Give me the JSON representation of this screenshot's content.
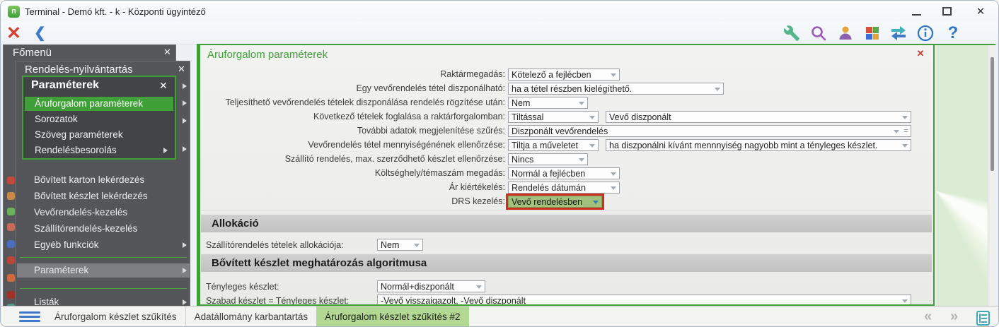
{
  "window": {
    "title": "Terminal - Demó kft. - k - Központi ügyintéző",
    "app_icon_letter": "n"
  },
  "icons": {
    "exit_x": "✕",
    "back_chevron": "❮",
    "window_close_x": "✕",
    "panel_close_x": "✕",
    "sidebar_close_x": "✕",
    "help_question": "?",
    "page_prev": "«",
    "page_next": "»",
    "equals_glyph": "="
  },
  "sidebar": {
    "fomenu": {
      "title": "Főmenü"
    },
    "orders_panel": {
      "title": "Rendelés-nyilvántartás",
      "items": [
        {
          "label": "Bővített karton lekérdezés"
        },
        {
          "label": "Bővített készlet lekérdezés"
        },
        {
          "label": "Vevőrendelés-kezelés"
        },
        {
          "label": "Szállítórendelés-kezelés"
        },
        {
          "label": "Egyéb funkciók"
        },
        {
          "label": "Paraméterek"
        },
        {
          "label": "Listák"
        }
      ]
    },
    "params_panel": {
      "title": "Paraméterek",
      "items": [
        {
          "label": "Áruforgalom paraméterek",
          "selected": true
        },
        {
          "label": "Sorozatok"
        },
        {
          "label": "Szöveg paraméterek"
        },
        {
          "label": "Rendelésbesorolás"
        }
      ]
    }
  },
  "main": {
    "title": "Áruforgalom paraméterek",
    "rows": [
      {
        "label": "Raktármegadás:",
        "value": "Kötelező a fejlécben"
      },
      {
        "label": "Egy vevőrendelés tétel diszponálható:",
        "value": "ha a tétel részben kielégíthető."
      },
      {
        "label": "Teljesíthető vevőrendelés tételek diszponálása rendelés rögzítése után:",
        "value": "Nem"
      },
      {
        "label": "Következő tételek foglalása a raktárforgalomban:",
        "value": "Tiltással",
        "value2": "Vevő diszponált"
      },
      {
        "label": "További adatok megjelenítése szűrés:",
        "value": "Diszponált vevőrendelés"
      },
      {
        "label": "Vevőrendelés tétel mennyiségénének ellenőrzése:",
        "value": "Tiltja a műveletet",
        "value2": "ha diszponálni kívánt mennnyiség nagyobb mint a tényleges készlet."
      },
      {
        "label": "Szállító rendelés, max. szerződhető készlet ellenőrzése:",
        "value": "Nincs"
      },
      {
        "label": "Költséghely/témaszám megadás:",
        "value": "Normál a fejlécben"
      },
      {
        "label": "Ár kiértékelés:",
        "value": "Rendelés dátumán"
      },
      {
        "label": "DRS kezelés:",
        "value": "Vevő rendelésben"
      }
    ],
    "sections": [
      {
        "title": "Allokáció",
        "rows": [
          {
            "label": "Szállítórendelés tételek allokációja:",
            "value": "Nem"
          }
        ]
      },
      {
        "title": "Bővített készlet meghatározás algoritmusa",
        "rows": [
          {
            "label": "Tényleges készlet:",
            "value": "Normál+diszponált"
          },
          {
            "label": "Szabad készlet = Tényleges készlet:",
            "value": "-Vevő visszaigazolt, -Vevő diszponált"
          }
        ]
      }
    ]
  },
  "bottom_bar": {
    "tabs": [
      {
        "label": "Áruforgalom készlet szűkítés",
        "active": false
      },
      {
        "label": "Adatállomány karbantartás",
        "active": false
      },
      {
        "label": "Áruforgalom készlet szűkítés #2",
        "active": true
      }
    ]
  },
  "colors": {
    "accent_green": "#3fa037",
    "highlight_border_red": "#cf2e20",
    "drs_field_green": "#a2c17c",
    "active_tab_green": "#b2d893",
    "sidebar_gray": "#555658"
  }
}
